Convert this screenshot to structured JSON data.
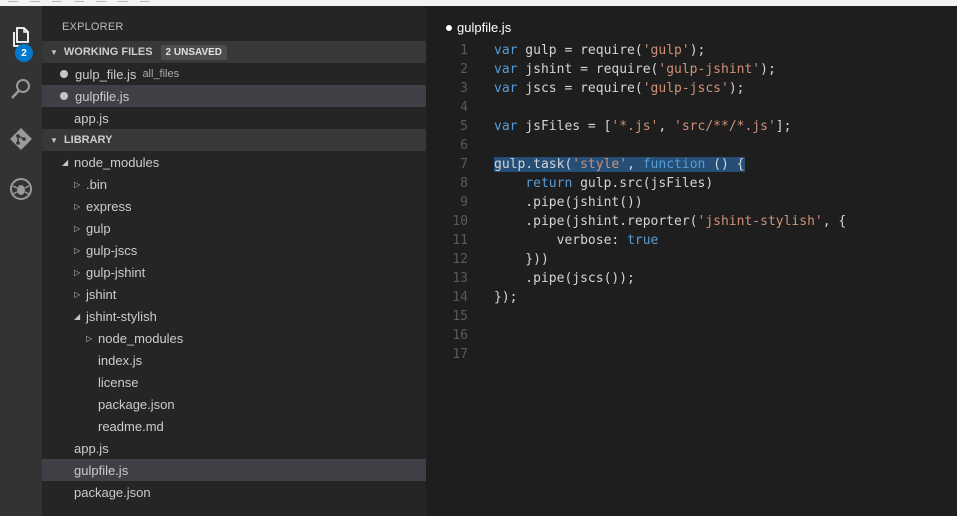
{
  "colors": {
    "activity_bar": "#333333",
    "sidebar": "#252526",
    "section_header": "#383838",
    "editor": "#1e1e1e",
    "badge": "#007acc",
    "keyword": "#569cd6",
    "string": "#ce9178",
    "selection": "#264f78"
  },
  "activity_bar": {
    "items": [
      {
        "icon": "files-icon",
        "badge": "2"
      },
      {
        "icon": "search-icon"
      },
      {
        "icon": "git-icon"
      },
      {
        "icon": "debug-icon"
      }
    ]
  },
  "sidebar": {
    "title": "EXPLORER",
    "working_files": {
      "header": "WORKING FILES",
      "badge": "2 UNSAVED",
      "items": [
        {
          "label": "gulp_file.js",
          "desc": "all_files",
          "unsaved": true
        },
        {
          "label": "gulpfile.js",
          "desc": "",
          "unsaved": true,
          "selected": true
        },
        {
          "label": "app.js",
          "desc": "",
          "unsaved": false
        }
      ]
    },
    "library": {
      "header": "LIBRARY",
      "tree": [
        {
          "label": "node_modules",
          "twisty": "open",
          "depth": 1
        },
        {
          "label": ".bin",
          "twisty": "closed",
          "depth": 2
        },
        {
          "label": "express",
          "twisty": "closed",
          "depth": 2
        },
        {
          "label": "gulp",
          "twisty": "closed",
          "depth": 2
        },
        {
          "label": "gulp-jscs",
          "twisty": "closed",
          "depth": 2
        },
        {
          "label": "gulp-jshint",
          "twisty": "closed",
          "depth": 2
        },
        {
          "label": "jshint",
          "twisty": "closed",
          "depth": 2
        },
        {
          "label": "jshint-stylish",
          "twisty": "open",
          "depth": 2
        },
        {
          "label": "node_modules",
          "twisty": "closed",
          "depth": 3
        },
        {
          "label": "index.js",
          "twisty": "none",
          "depth": 3
        },
        {
          "label": "license",
          "twisty": "none",
          "depth": 3
        },
        {
          "label": "package.json",
          "twisty": "none",
          "depth": 3
        },
        {
          "label": "readme.md",
          "twisty": "none",
          "depth": 3
        },
        {
          "label": "app.js",
          "twisty": "none",
          "depth": 1
        },
        {
          "label": "gulpfile.js",
          "twisty": "none",
          "depth": 1,
          "selected": true
        },
        {
          "label": "package.json",
          "twisty": "none",
          "depth": 1
        }
      ]
    }
  },
  "editor": {
    "tab_title": "gulpfile.js",
    "lines": [
      {
        "n": "1",
        "tokens": [
          [
            "kw",
            "var"
          ],
          [
            "p",
            " gulp = require("
          ],
          [
            "str",
            "'gulp'"
          ],
          [
            "p",
            ");"
          ]
        ]
      },
      {
        "n": "2",
        "tokens": [
          [
            "kw",
            "var"
          ],
          [
            "p",
            " jshint = require("
          ],
          [
            "str",
            "'gulp-jshint'"
          ],
          [
            "p",
            ");"
          ]
        ]
      },
      {
        "n": "3",
        "tokens": [
          [
            "kw",
            "var"
          ],
          [
            "p",
            " jscs = require("
          ],
          [
            "str",
            "'gulp-jscs'"
          ],
          [
            "p",
            ");"
          ]
        ]
      },
      {
        "n": "4",
        "tokens": []
      },
      {
        "n": "5",
        "tokens": [
          [
            "kw",
            "var"
          ],
          [
            "p",
            " jsFiles = ["
          ],
          [
            "str",
            "'*.js'"
          ],
          [
            "p",
            ", "
          ],
          [
            "str",
            "'src/**/*.js'"
          ],
          [
            "p",
            "];"
          ]
        ]
      },
      {
        "n": "6",
        "tokens": []
      },
      {
        "n": "7",
        "highlight": true,
        "tokens": [
          [
            "p",
            "gulp.task("
          ],
          [
            "str",
            "'style'"
          ],
          [
            "p",
            ", "
          ],
          [
            "kw",
            "function"
          ],
          [
            "p",
            " () {"
          ]
        ]
      },
      {
        "n": "8",
        "tokens": [
          [
            "p",
            "    "
          ],
          [
            "kw",
            "return"
          ],
          [
            "p",
            " gulp.src(jsFiles)"
          ]
        ]
      },
      {
        "n": "9",
        "tokens": [
          [
            "p",
            "    .pipe(jshint())"
          ]
        ]
      },
      {
        "n": "10",
        "tokens": [
          [
            "p",
            "    .pipe(jshint.reporter("
          ],
          [
            "str",
            "'jshint-stylish'"
          ],
          [
            "p",
            ", {"
          ]
        ]
      },
      {
        "n": "11",
        "tokens": [
          [
            "p",
            "        verbose: "
          ],
          [
            "kw",
            "true"
          ]
        ]
      },
      {
        "n": "12",
        "tokens": [
          [
            "p",
            "    }))"
          ]
        ]
      },
      {
        "n": "13",
        "tokens": [
          [
            "p",
            "    .pipe(jscs());"
          ]
        ]
      },
      {
        "n": "14",
        "tokens": [
          [
            "p",
            "});"
          ]
        ]
      },
      {
        "n": "15",
        "tokens": []
      },
      {
        "n": "16",
        "tokens": []
      },
      {
        "n": "17",
        "tokens": []
      }
    ]
  }
}
